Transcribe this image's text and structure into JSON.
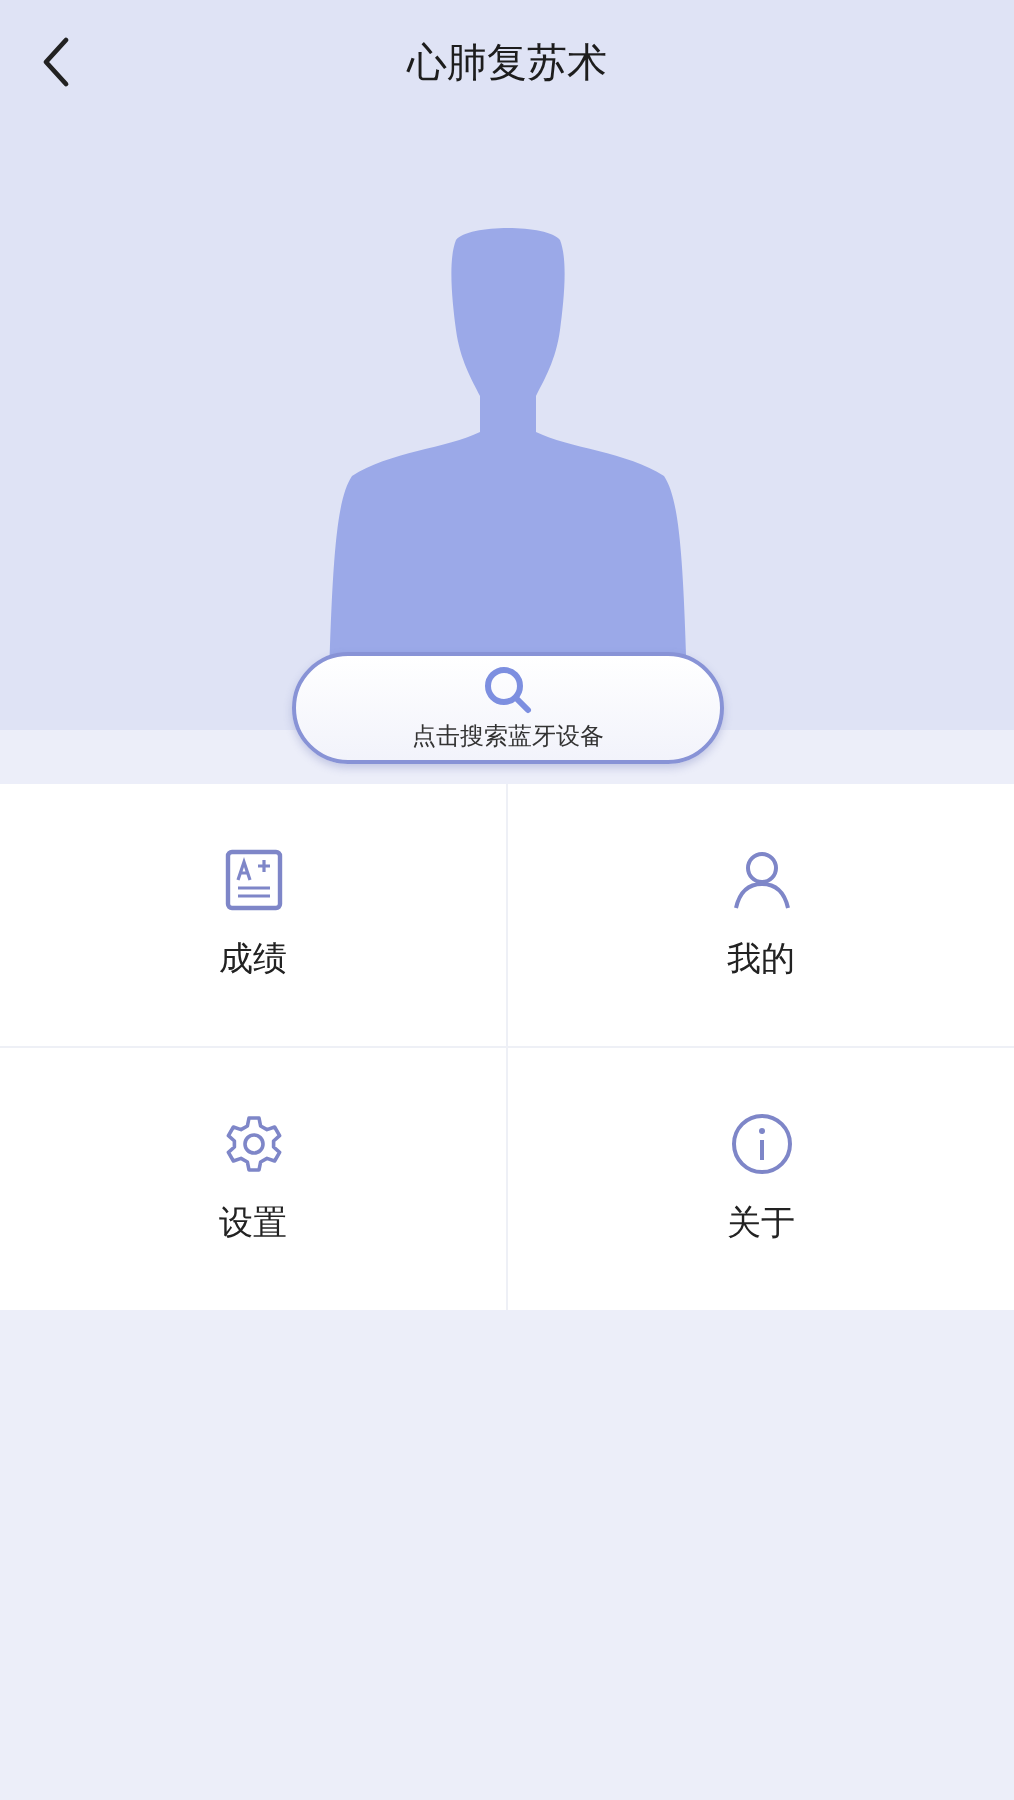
{
  "header": {
    "title": "心肺复苏术"
  },
  "search_button": {
    "label": "点击搜索蓝牙设备"
  },
  "menu": [
    {
      "kind": "scores",
      "label": "成绩"
    },
    {
      "kind": "profile",
      "label": "我的"
    },
    {
      "kind": "settings",
      "label": "设置"
    },
    {
      "kind": "about",
      "label": "关于"
    }
  ]
}
